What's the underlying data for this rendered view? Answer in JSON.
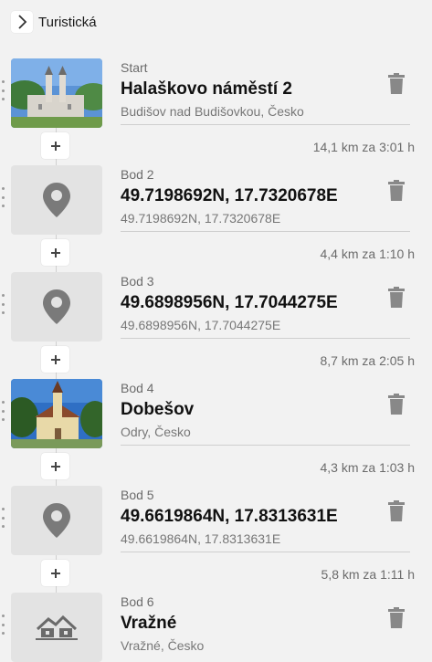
{
  "route_mode": {
    "label": "Turistická",
    "toggle_icon": "chevron-right-icon"
  },
  "colors": {
    "background": "#f2f2f2",
    "icon_gray": "#888888",
    "text_dark": "#111111",
    "text_muted": "#777777"
  },
  "waypoints": [
    {
      "kind": "Start",
      "title": "Halaškovo náměstí 2",
      "subtitle": "Budišov nad Budišovkou, Česko",
      "thumb": "photo-church-icon"
    },
    {
      "kind": "Bod 2",
      "title": "49.7198692N, 17.7320678E",
      "subtitle": "49.7198692N, 17.7320678E",
      "thumb": "map-pin-icon"
    },
    {
      "kind": "Bod 3",
      "title": "49.6898956N, 17.7044275E",
      "subtitle": "49.6898956N, 17.7044275E",
      "thumb": "map-pin-icon"
    },
    {
      "kind": "Bod 4",
      "title": "Dobešov",
      "subtitle": "Odry, Česko",
      "thumb": "photo-chapel-icon"
    },
    {
      "kind": "Bod 5",
      "title": "49.6619864N, 17.8313631E",
      "subtitle": "49.6619864N, 17.8313631E",
      "thumb": "map-pin-icon"
    },
    {
      "kind": "Bod 6",
      "title": "Vražné",
      "subtitle": "Vražné, Česko",
      "thumb": "village-icon"
    }
  ],
  "segments": [
    {
      "info": "14,1 km za 3:01 h"
    },
    {
      "info": "4,4 km za 1:10 h"
    },
    {
      "info": "8,7 km za 2:05 h"
    },
    {
      "info": "4,3 km za 1:03 h"
    },
    {
      "info": "5,8 km za 1:11 h"
    }
  ]
}
